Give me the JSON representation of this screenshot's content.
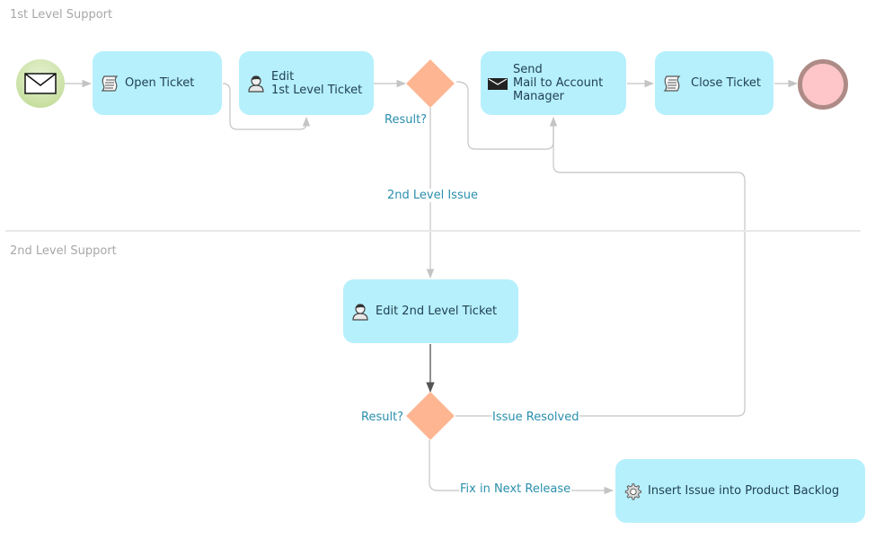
{
  "lanes": [
    {
      "name": "1st Level Support"
    },
    {
      "name": "2nd Level Support"
    }
  ],
  "events": {
    "start": {
      "type": "message-start",
      "icon": "envelope-icon",
      "fill": "#c9e0a3"
    },
    "end": {
      "type": "end",
      "fill": "#fec6c9",
      "stroke": "#ae8b86"
    }
  },
  "tasks": {
    "open_ticket": {
      "label": "Open Ticket",
      "icon": "script-icon"
    },
    "edit_1st": {
      "label": "Edit\n1st Level Ticket",
      "icon": "user-icon"
    },
    "send_mail": {
      "label": "Send\nMail to Account\nManager",
      "icon": "send-mail-icon"
    },
    "close_ticket": {
      "label": "Close Ticket",
      "icon": "script-icon"
    },
    "edit_2nd": {
      "label": "Edit 2nd Level Ticket",
      "icon": "user-icon"
    },
    "insert_backlog": {
      "label": "Insert Issue into Product Backlog",
      "icon": "gear-icon"
    }
  },
  "gateways": {
    "g1": {
      "label": "Result?"
    },
    "g2": {
      "label": "Result?"
    }
  },
  "edge_labels": {
    "second_level_issue": "2nd Level Issue",
    "issue_resolved": "Issue Resolved",
    "fix_next_release": "Fix in Next Release"
  },
  "colors": {
    "task_fill": "#b6f0fc",
    "task_text": "#1f3f52",
    "gateway_fill": "#feb592",
    "edge_label": "#2a8fad",
    "lane_label": "#a8a8a8",
    "connector": "#bdbdbd"
  }
}
